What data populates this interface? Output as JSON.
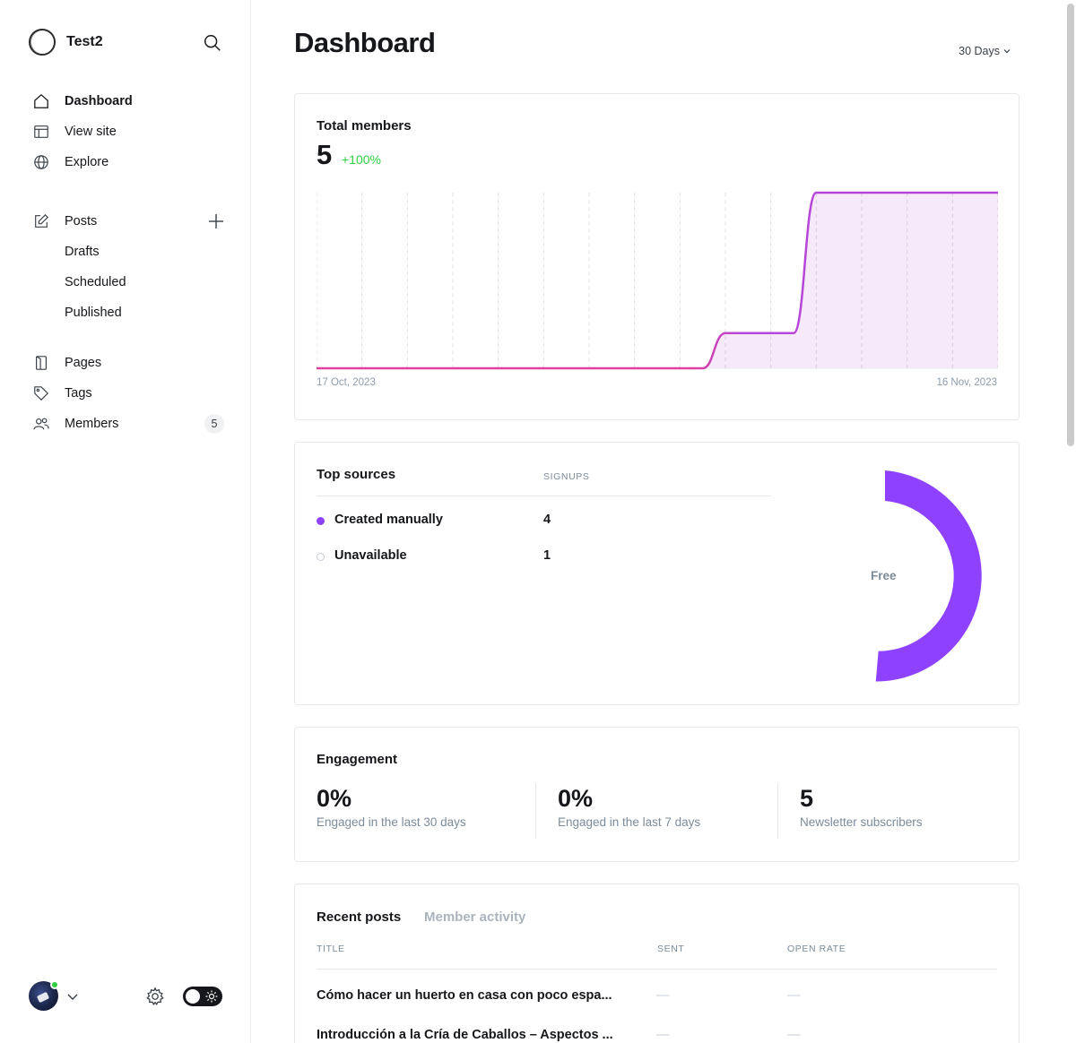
{
  "brand": {
    "name": "Test2"
  },
  "nav": {
    "dashboard": "Dashboard",
    "view_site": "View site",
    "explore": "Explore",
    "posts": "Posts",
    "drafts": "Drafts",
    "scheduled": "Scheduled",
    "published": "Published",
    "pages": "Pages",
    "tags": "Tags",
    "members": "Members",
    "members_count": "5"
  },
  "header": {
    "title": "Dashboard",
    "period": "30 Days"
  },
  "members_card": {
    "title": "Total members",
    "value": "5",
    "change": "+100%",
    "x_start": "17 Oct, 2023",
    "x_end": "16 Nov, 2023"
  },
  "sources": {
    "title": "Top sources",
    "col_signups": "SIGNUPS",
    "rows": [
      {
        "name": "Created manually",
        "value": "4"
      },
      {
        "name": "Unavailable",
        "value": "1"
      }
    ],
    "donut_label": "Free"
  },
  "engagement": {
    "title": "Engagement",
    "items": [
      {
        "value": "0%",
        "label": "Engaged in the last 30 days"
      },
      {
        "value": "0%",
        "label": "Engaged in the last 7 days"
      },
      {
        "value": "5",
        "label": "Newsletter subscribers"
      }
    ]
  },
  "recent": {
    "tab_posts": "Recent posts",
    "tab_activity": "Member activity",
    "col_title": "TITLE",
    "col_sent": "SENT",
    "col_open_rate": "OPEN RATE",
    "dash": "—",
    "rows": [
      {
        "title": "Cómo hacer un huerto en casa con poco espa..."
      },
      {
        "title": "Introducción a la Cría de Caballos – Aspectos ..."
      }
    ]
  },
  "colors": {
    "accent_purple": "#8e42ff",
    "line_purple": "#b646d9",
    "line_pink": "#e0409c",
    "positive": "#30cf43"
  },
  "chart_data": {
    "type": "area",
    "title": "Total members",
    "x_labels": [
      "17 Oct, 2023",
      "16 Nov, 2023"
    ],
    "series": [
      {
        "values": [
          0,
          0,
          0,
          0,
          0,
          0,
          0,
          0,
          0,
          0,
          0,
          0,
          0,
          0,
          0,
          0,
          0,
          0,
          1,
          1,
          1,
          1,
          5,
          5,
          5,
          5,
          5,
          5,
          5,
          5,
          5
        ]
      }
    ],
    "ylim": [
      0,
      5
    ],
    "grid": "vertical-dashed",
    "donut": {
      "type": "pie",
      "categories": [
        "Free"
      ],
      "values": [
        5
      ]
    }
  }
}
